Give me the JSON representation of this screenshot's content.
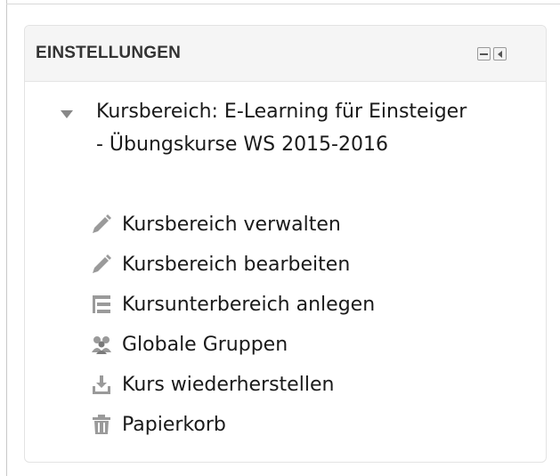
{
  "block": {
    "title": "EINSTELLUNGEN"
  },
  "tree": {
    "root_label": "Kursbereich: E-Learning für Einsteiger - Übungskurse WS 2015-2016",
    "items": [
      {
        "label": "Kursbereich verwalten",
        "icon": "pencil-icon"
      },
      {
        "label": "Kursbereich bearbeiten",
        "icon": "pencil-icon"
      },
      {
        "label": "Kursunterbereich anlegen",
        "icon": "subcategory-icon"
      },
      {
        "label": "Globale Gruppen",
        "icon": "cohort-icon"
      },
      {
        "label": "Kurs wiederherstellen",
        "icon": "restore-icon"
      },
      {
        "label": "Papierkorb",
        "icon": "trash-icon"
      }
    ]
  },
  "colors": {
    "text": "#1a1a1a",
    "icon": "#999999",
    "header_bg": "#f5f5f5"
  }
}
